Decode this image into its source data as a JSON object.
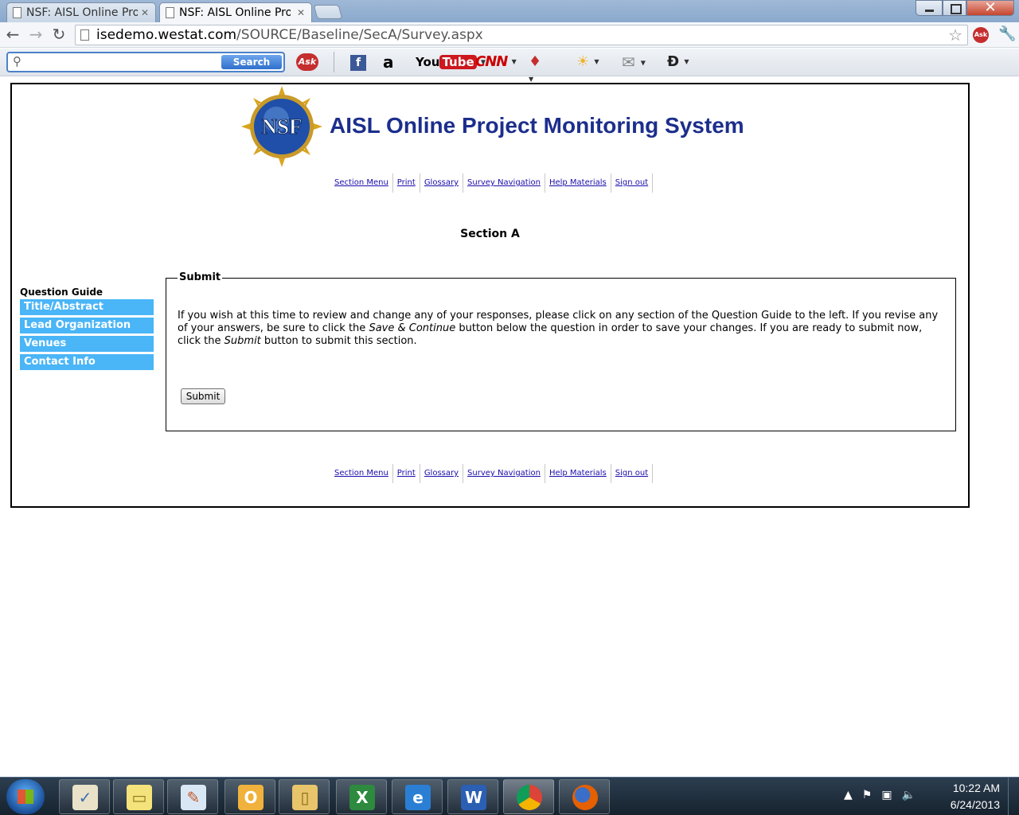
{
  "browser": {
    "tabs": [
      {
        "title": "NSF: AISL Online Proj",
        "active": false
      },
      {
        "title": "NSF: AISL Online Proj",
        "active": true
      }
    ],
    "url_host": "isedemo.westat.com",
    "url_path": "/SOURCE/Baseline/SecA/Survey.aspx",
    "ask_ext_label": "Ask"
  },
  "ask_toolbar": {
    "search_placeholder": "",
    "search_button": "Search",
    "ask_logo": "Ask",
    "facebook": "f",
    "amazon": "a",
    "youtube_you": "You",
    "youtube_tube": "Tube",
    "cnn": "CNN",
    "games": "♦",
    "weather": "☀",
    "mail": "✉",
    "dictionary": "Ð"
  },
  "page": {
    "site_title": "AISL Online Project Monitoring System",
    "logo_text": "NSF",
    "nav_links": [
      "Section Menu",
      "Print",
      "Glossary",
      "Survey Navigation",
      "Help Materials",
      "Sign out"
    ],
    "section_heading": "Section A",
    "question_guide": {
      "title": "Question Guide",
      "items": [
        "Title/Abstract",
        "Lead Organization",
        "Venues",
        "Contact Info"
      ]
    },
    "submit_box": {
      "legend": "Submit",
      "text_1": "If you wish at this time to review and change any of your responses, please click on any section of the Question Guide to the left. If you revise any of your answers, be sure to click the ",
      "save_continue": "Save & Continue",
      "text_2": " button below the question in order to save your changes. If you are ready to submit now, click the ",
      "submit_word": "Submit",
      "text_3": " button to submit this section.",
      "button_label": "Submit"
    }
  },
  "taskbar": {
    "apps": [
      "tasks",
      "sticky-notes",
      "paint",
      "outlook",
      "explorer",
      "excel",
      "internet-explorer",
      "word",
      "chrome",
      "firefox"
    ],
    "time": "10:22 AM",
    "date": "6/24/2013"
  },
  "colors": {
    "title_blue": "#1c2e8c",
    "guide_item_bg": "#4ab5f7",
    "link": "#1a0dab"
  }
}
